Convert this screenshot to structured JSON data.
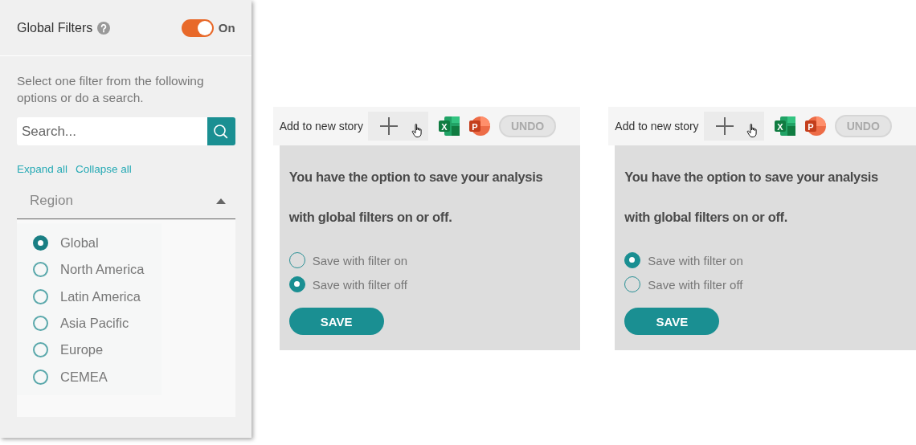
{
  "filter_panel": {
    "title": "Global Filters",
    "toggle": {
      "on": true,
      "label": "On"
    },
    "instructions": "Select one filter from the following options or do a search.",
    "search": {
      "placeholder": "Search..."
    },
    "links": [
      "Expand all",
      "Collapse all"
    ],
    "group": {
      "label": "Region",
      "expanded": true,
      "options": [
        {
          "label": "Global",
          "selected": true
        },
        {
          "label": "North America",
          "selected": false
        },
        {
          "label": "Latin America",
          "selected": false
        },
        {
          "label": "Asia Pacific",
          "selected": false
        },
        {
          "label": "Europe",
          "selected": false
        },
        {
          "label": "CEMEA",
          "selected": false
        }
      ]
    }
  },
  "save_panels": [
    {
      "toolbar": {
        "add_label": "Add to new story",
        "exports": [
          {
            "kind": "excel",
            "letter": "X"
          },
          {
            "kind": "powerpoint",
            "letter": "P"
          }
        ],
        "undo": {
          "label": "UNDO",
          "disabled": true
        }
      },
      "message": "You have the option to save your analysis with global filters on or off.",
      "options": [
        {
          "label": "Save with filter on",
          "selected": false
        },
        {
          "label": "Save with filter off",
          "selected": true
        }
      ],
      "button": "SAVE"
    },
    {
      "toolbar": {
        "add_label": "Add to new story",
        "exports": [
          {
            "kind": "excel",
            "letter": "X"
          },
          {
            "kind": "powerpoint",
            "letter": "P"
          }
        ],
        "undo": {
          "label": "UNDO",
          "disabled": true
        }
      },
      "message": "You have the option to save your analysis with global filters on or off.",
      "options": [
        {
          "label": "Save with filter on",
          "selected": true
        },
        {
          "label": "Save with filter off",
          "selected": false
        }
      ],
      "button": "SAVE"
    }
  ]
}
